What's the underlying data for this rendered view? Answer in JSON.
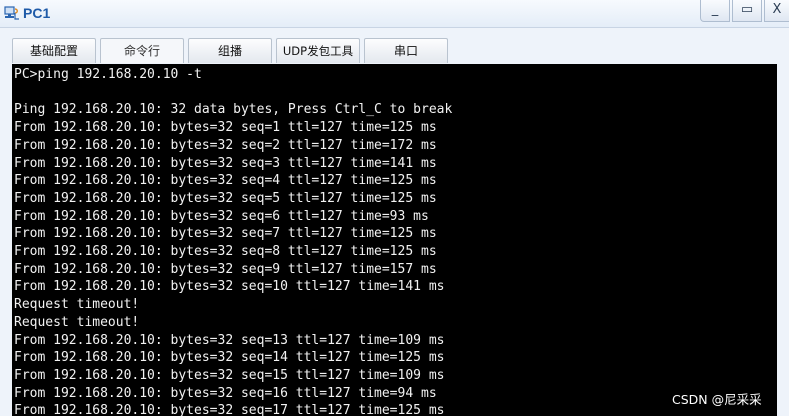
{
  "window": {
    "title": "PC1",
    "minimize_label": "_",
    "maximize_label": "▭",
    "close_label": "X"
  },
  "tabs": [
    {
      "label": "基础配置",
      "active": false
    },
    {
      "label": "命令行",
      "active": true
    },
    {
      "label": "组播",
      "active": false
    },
    {
      "label": "UDP发包工具",
      "active": false
    },
    {
      "label": "串口",
      "active": false
    }
  ],
  "terminal": {
    "lines": [
      "PC>ping 192.168.20.10 -t",
      "",
      "Ping 192.168.20.10: 32 data bytes, Press Ctrl_C to break",
      "From 192.168.20.10: bytes=32 seq=1 ttl=127 time=125 ms",
      "From 192.168.20.10: bytes=32 seq=2 ttl=127 time=172 ms",
      "From 192.168.20.10: bytes=32 seq=3 ttl=127 time=141 ms",
      "From 192.168.20.10: bytes=32 seq=4 ttl=127 time=125 ms",
      "From 192.168.20.10: bytes=32 seq=5 ttl=127 time=125 ms",
      "From 192.168.20.10: bytes=32 seq=6 ttl=127 time=93 ms",
      "From 192.168.20.10: bytes=32 seq=7 ttl=127 time=125 ms",
      "From 192.168.20.10: bytes=32 seq=8 ttl=127 time=125 ms",
      "From 192.168.20.10: bytes=32 seq=9 ttl=127 time=157 ms",
      "From 192.168.20.10: bytes=32 seq=10 ttl=127 time=141 ms",
      "Request timeout!",
      "Request timeout!",
      "From 192.168.20.10: bytes=32 seq=13 ttl=127 time=109 ms",
      "From 192.168.20.10: bytes=32 seq=14 ttl=127 time=125 ms",
      "From 192.168.20.10: bytes=32 seq=15 ttl=127 time=109 ms",
      "From 192.168.20.10: bytes=32 seq=16 ttl=127 time=94 ms",
      "From 192.168.20.10: bytes=32 seq=17 ttl=127 time=125 ms"
    ]
  },
  "watermark": "CSDN @尼采采",
  "colors": {
    "terminal_bg": "#000000",
    "terminal_fg": "#f2f2f2",
    "title_text": "#1e5aa8"
  }
}
